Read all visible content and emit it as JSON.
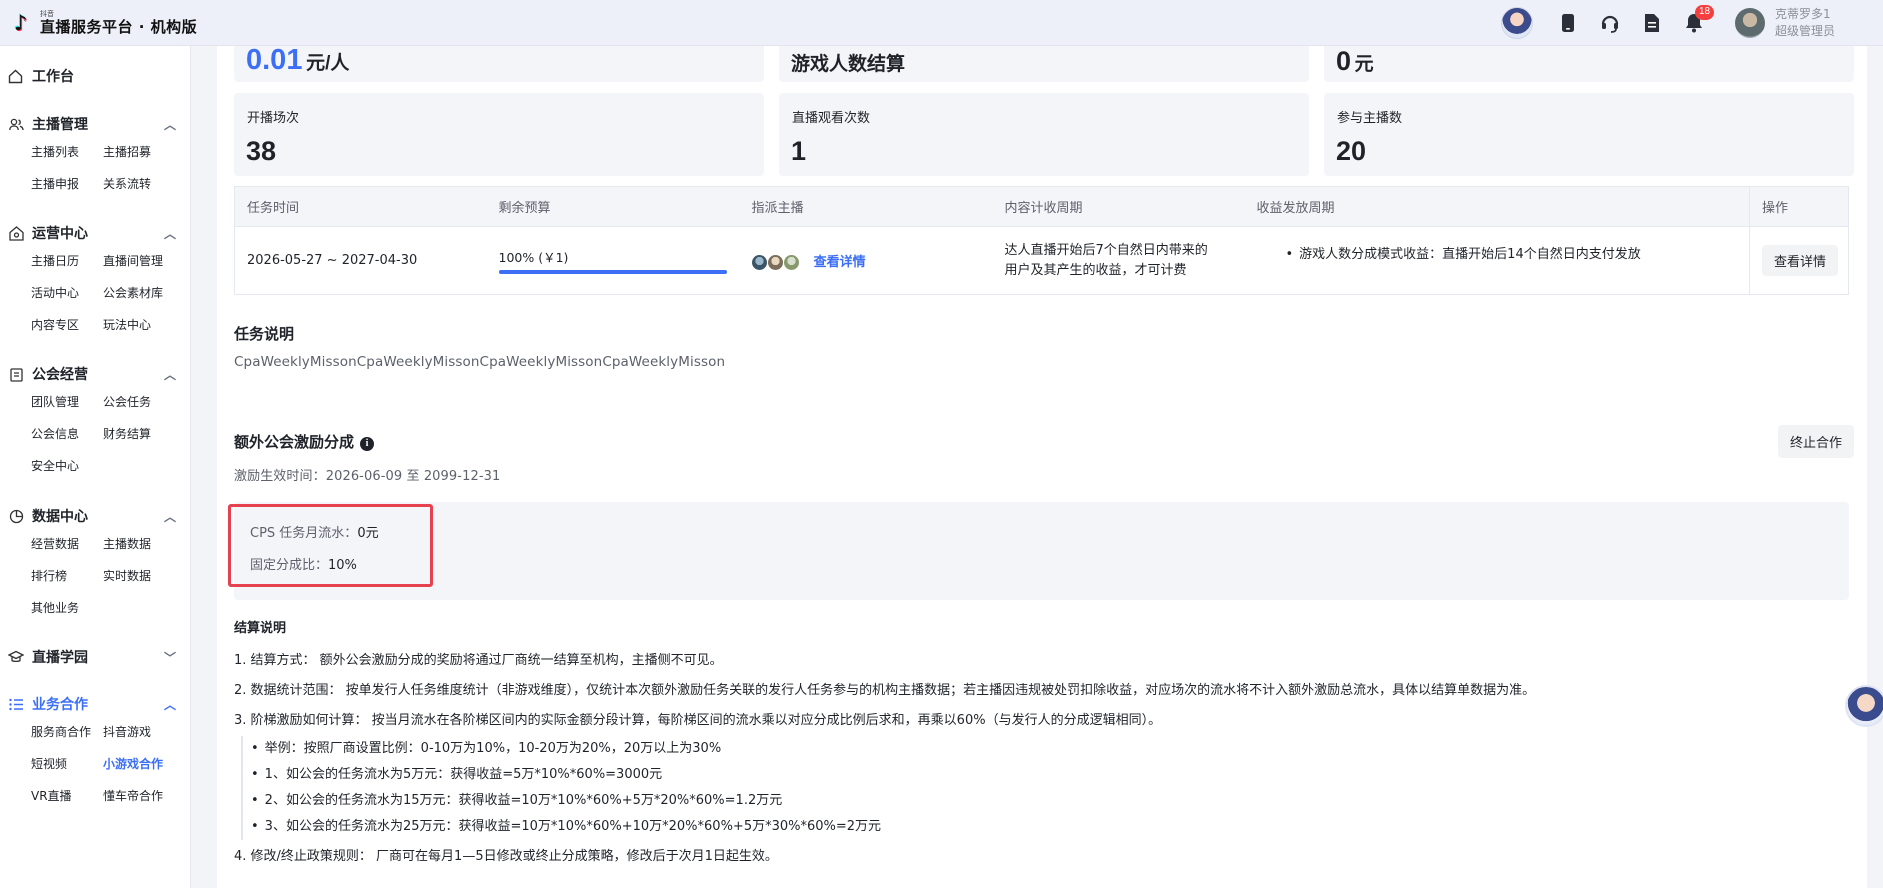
{
  "header": {
    "brand_small": "抖音",
    "title": "直播服务平台 · 机构版",
    "notification_count": "18",
    "user_name": "克蒂罗多1",
    "user_role": "超级管理员"
  },
  "sidebar": {
    "workbench": "工作台",
    "groups": [
      {
        "title": "主播管理",
        "items": [
          "主播列表",
          "主播招募",
          "主播申报",
          "关系流转"
        ]
      },
      {
        "title": "运营中心",
        "items": [
          "主播日历",
          "直播间管理",
          "活动中心",
          "公会素材库",
          "内容专区",
          "玩法中心"
        ]
      },
      {
        "title": "公会经营",
        "items": [
          "团队管理",
          "公会任务",
          "公会信息",
          "财务结算",
          "安全中心"
        ]
      },
      {
        "title": "数据中心",
        "items": [
          "经营数据",
          "主播数据",
          "排行榜",
          "实时数据",
          "其他业务"
        ]
      },
      {
        "title": "直播学园",
        "items": []
      },
      {
        "title": "业务合作",
        "items": [
          "服务商合作",
          "抖音游戏",
          "短视频",
          "小游戏合作",
          "VR直播",
          "懂车帝合作"
        ]
      }
    ]
  },
  "stats_top": {
    "price_value": "0.01",
    "price_unit": "元/人",
    "settle_type": "游戏人数结算",
    "amount_value": "0",
    "amount_unit": "元"
  },
  "stats": [
    {
      "label": "开播场次",
      "value": "38"
    },
    {
      "label": "直播观看次数",
      "value": "1"
    },
    {
      "label": "参与主播数",
      "value": "20"
    }
  ],
  "task_table": {
    "headers": [
      "任务时间",
      "剩余预算",
      "指派主播",
      "内容计收周期",
      "收益发放周期",
      "操作"
    ],
    "row": {
      "time": "2026-05-27 ~ 2027-04-30",
      "budget": "100% (￥1)",
      "budget_percent": 100,
      "detail_link": "查看详情",
      "content_cycle_line1": "达人直播开始后7个自然日内带来的",
      "content_cycle_line2": "用户及其产生的收益，才可计费",
      "payout_cycle": "游戏人数分成模式收益：直播开始后14个自然日内支付发放",
      "op_button": "查看详情"
    }
  },
  "task_desc": {
    "title": "任务说明",
    "text": "CpaWeeklyMissonCpaWeeklyMissonCpaWeeklyMissonCpaWeeklyMisson"
  },
  "extra": {
    "title": "额外公会激励分成",
    "end_button": "终止合作",
    "effective_time": "激励生效时间：2026-06-09 至 2099-12-31",
    "cps_label": "CPS 任务月流水：",
    "cps_value": "0元",
    "ratio_label": "固定分成比：",
    "ratio_value": "10%"
  },
  "rules": {
    "title": "结算说明",
    "lines": [
      "1. 结算方式： 额外公会激励分成的奖励将通过厂商统一结算至机构，主播侧不可见。",
      "2. 数据统计范围： 按单发行人任务维度统计（非游戏维度），仅统计本次额外激励任务关联的发行人任务参与的机构主播数据；若主播因违规被处罚扣除收益，对应场次的流水将不计入额外激励总流水，具体以结算单数据为准。",
      "3. 阶梯激励如何计算： 按当月流水在各阶梯区间内的实际金额分段计算，每阶梯区间的流水乘以对应分成比例后求和，再乘以60%（与发行人的分成逻辑相同）。"
    ],
    "sub_lines": [
      "举例：按照厂商设置比例：0-10万为10%，10-20万为20%，20万以上为30%",
      "1、如公会的任务流水为5万元：获得收益=5万*10%*60%=3000元",
      "2、如公会的任务流水为15万元：获得收益=10万*10%*60%+5万*20%*60%=1.2万元",
      "3、如公会的任务流水为25万元：获得收益=10万*10%*60%+10万*20%*60%+5万*30%*60%=2万元"
    ],
    "last_line": "4. 修改/终止政策规则： 厂商可在每月1—5日修改或终止分成策略，修改后于次月1日起生效。"
  },
  "colors": {
    "accent": "#3c6ff5",
    "highlight_border": "#e5414e",
    "badge": "#f53f3f"
  }
}
